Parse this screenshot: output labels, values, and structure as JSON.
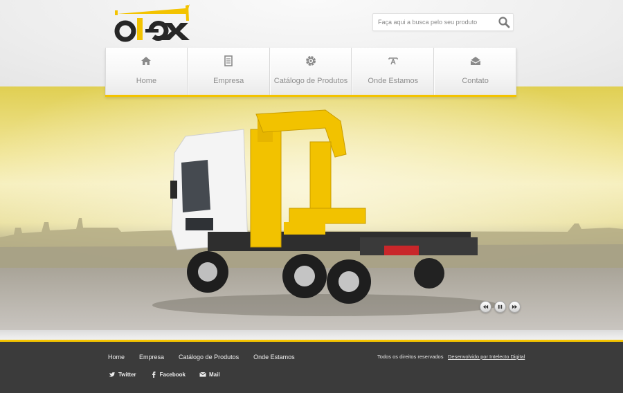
{
  "brand": {
    "logo_text": "otex",
    "accent_color": "#f3c300",
    "dark_color": "#222222"
  },
  "search": {
    "placeholder": "Faça aqui a busca pelo seu produto",
    "icon": "search-icon"
  },
  "nav": {
    "items": [
      {
        "label": "Home",
        "icon": "home-icon"
      },
      {
        "label": "Empresa",
        "icon": "document-icon"
      },
      {
        "label": "Catálogo de Produtos",
        "icon": "gear-icon"
      },
      {
        "label": "Onde Estamos",
        "icon": "map-icon"
      },
      {
        "label": "Contato",
        "icon": "envelope-icon"
      }
    ]
  },
  "slider": {
    "image": "yellow-crane-truck-photo",
    "controls": [
      {
        "name": "previous",
        "icon": "rewind-icon"
      },
      {
        "name": "pause",
        "icon": "pause-icon"
      },
      {
        "name": "next",
        "icon": "fast-forward-icon"
      }
    ]
  },
  "footer": {
    "nav": [
      "Home",
      "Empresa",
      "Catálogo de Produtos",
      "Onde Estamos"
    ],
    "social": [
      {
        "label": "Twitter",
        "icon": "twitter-icon"
      },
      {
        "label": "Facebook",
        "icon": "facebook-icon"
      },
      {
        "label": "Mail",
        "icon": "mail-icon"
      }
    ],
    "copyright": "Todos os direitos reservados",
    "credit": "Desenvolvido por Intelecto Digital",
    "background_color": "#3b3b3b"
  }
}
